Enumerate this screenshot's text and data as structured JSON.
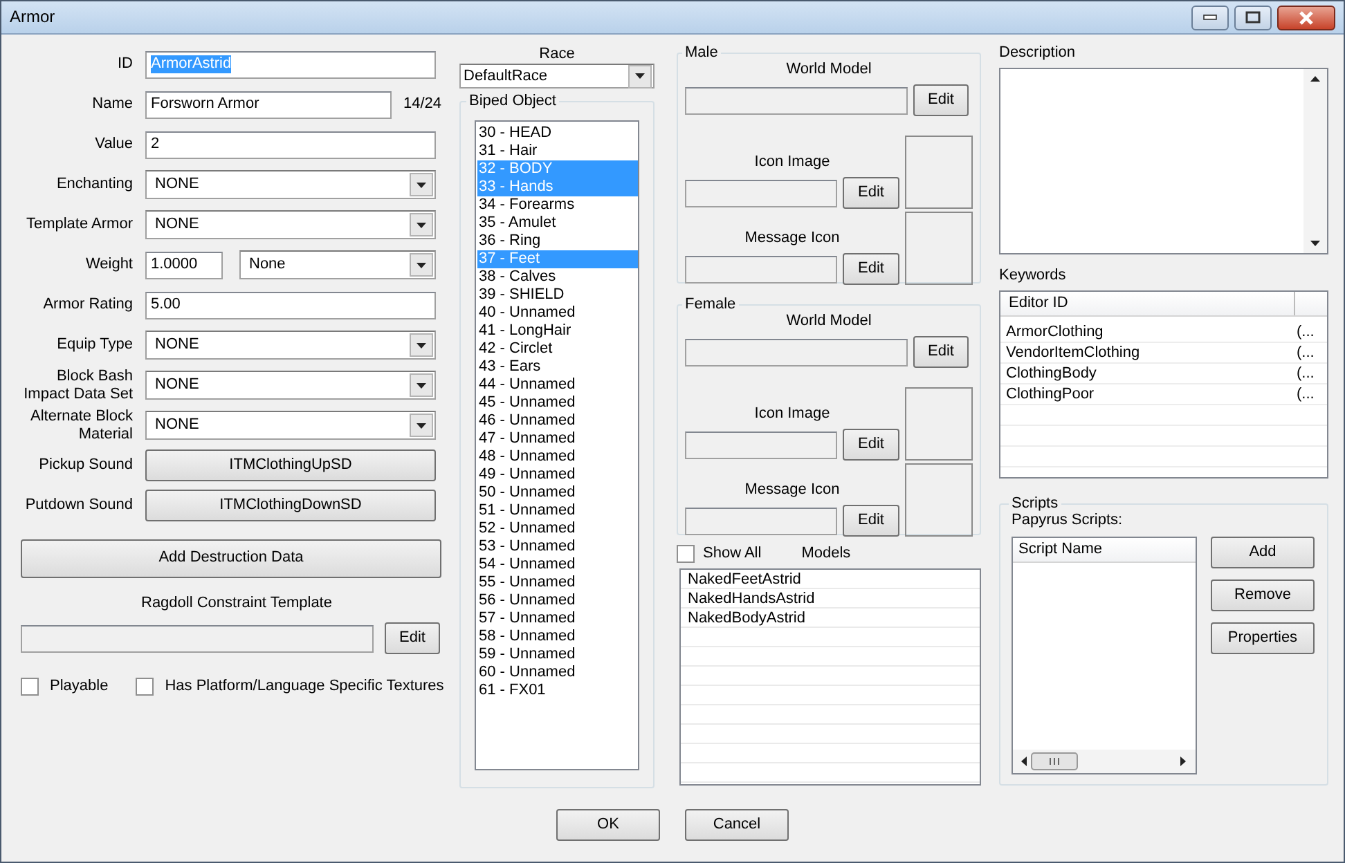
{
  "window": {
    "title": "Armor"
  },
  "fields": [
    {
      "kind": "text",
      "label": "ID",
      "value": "ArmorAstrid",
      "value_selected": true
    },
    {
      "kind": "text",
      "label": "Name",
      "value": "Forsworn Armor",
      "value_selected": false,
      "counter": "14/24"
    },
    {
      "kind": "text",
      "label": "Value",
      "value": "2",
      "value_selected": false
    },
    {
      "kind": "combo",
      "label": "Enchanting",
      "value": "NONE"
    },
    {
      "kind": "combo",
      "label": "Template Armor",
      "value": "NONE"
    },
    {
      "kind": "weight",
      "label": "Weight",
      "value": "1.0000",
      "option": "None"
    },
    {
      "kind": "text",
      "label": "Armor Rating",
      "value": "5.00",
      "value_selected": false
    },
    {
      "kind": "combo",
      "label": "Equip Type",
      "value": "NONE"
    },
    {
      "kind": "combo",
      "label": "Block Bash Impact Data Set",
      "value": "NONE"
    },
    {
      "kind": "combo",
      "label": "Alternate Block Material",
      "value": "NONE"
    },
    {
      "kind": "button",
      "label": "Pickup Sound",
      "value": "ITMClothingUpSD"
    },
    {
      "kind": "button",
      "label": "Putdown Sound",
      "value": "ITMClothingDownSD"
    }
  ],
  "destruction_button": "Add Destruction Data",
  "ragdoll": {
    "label": "Ragdoll Constraint Template",
    "button": "Edit"
  },
  "checkboxes": [
    {
      "label": "Playable",
      "checked": false
    },
    {
      "label": "Has Platform/Language Specific Textures",
      "checked": false
    }
  ],
  "race": {
    "label": "Race",
    "value": "DefaultRace"
  },
  "biped_object": {
    "title": "Biped Object",
    "items": [
      {
        "label": "30 - HEAD",
        "selected": false
      },
      {
        "label": "31 - Hair",
        "selected": false
      },
      {
        "label": "32 - BODY",
        "selected": true
      },
      {
        "label": "33 - Hands",
        "selected": true
      },
      {
        "label": "34 - Forearms",
        "selected": false
      },
      {
        "label": "35 - Amulet",
        "selected": false
      },
      {
        "label": "36 - Ring",
        "selected": false
      },
      {
        "label": "37 - Feet",
        "selected": true
      },
      {
        "label": "38 - Calves",
        "selected": false
      },
      {
        "label": "39 - SHIELD",
        "selected": false
      },
      {
        "label": "40 - Unnamed",
        "selected": false
      },
      {
        "label": "41 - LongHair",
        "selected": false
      },
      {
        "label": "42 - Circlet",
        "selected": false
      },
      {
        "label": "43 - Ears",
        "selected": false
      },
      {
        "label": "44 - Unnamed",
        "selected": false
      },
      {
        "label": "45 - Unnamed",
        "selected": false
      },
      {
        "label": "46 - Unnamed",
        "selected": false
      },
      {
        "label": "47 - Unnamed",
        "selected": false
      },
      {
        "label": "48 - Unnamed",
        "selected": false
      },
      {
        "label": "49 - Unnamed",
        "selected": false
      },
      {
        "label": "50 - Unnamed",
        "selected": false
      },
      {
        "label": "51 - Unnamed",
        "selected": false
      },
      {
        "label": "52 - Unnamed",
        "selected": false
      },
      {
        "label": "53 - Unnamed",
        "selected": false
      },
      {
        "label": "54 - Unnamed",
        "selected": false
      },
      {
        "label": "55 - Unnamed",
        "selected": false
      },
      {
        "label": "56 - Unnamed",
        "selected": false
      },
      {
        "label": "57 - Unnamed",
        "selected": false
      },
      {
        "label": "58 - Unnamed",
        "selected": false
      },
      {
        "label": "59 - Unnamed",
        "selected": false
      },
      {
        "label": "60 - Unnamed",
        "selected": false
      },
      {
        "label": "61 - FX01",
        "selected": false
      }
    ]
  },
  "genders": [
    {
      "title": "Male",
      "sections": [
        {
          "kind": "model",
          "label": "World Model",
          "button": "Edit"
        },
        {
          "kind": "image",
          "label": "Icon Image",
          "button": "Edit"
        },
        {
          "kind": "image",
          "label": "Message Icon",
          "button": "Edit"
        }
      ]
    },
    {
      "title": "Female",
      "sections": [
        {
          "kind": "model",
          "label": "World Model",
          "button": "Edit"
        },
        {
          "kind": "image",
          "label": "Icon Image",
          "button": "Edit"
        },
        {
          "kind": "image",
          "label": "Message Icon",
          "button": "Edit"
        }
      ]
    }
  ],
  "models": {
    "show_all": {
      "label": "Show All",
      "checked": false
    },
    "title": "Models",
    "items": [
      "NakedFeetAstrid",
      "NakedHandsAstrid",
      "NakedBodyAstrid"
    ]
  },
  "description": {
    "label": "Description"
  },
  "keywords": {
    "label": "Keywords",
    "columns": [
      "Editor ID"
    ],
    "rows": [
      {
        "editor_id": "ArmorClothing",
        "column_2": "(..."
      },
      {
        "editor_id": "VendorItemClothing",
        "column_2": "(..."
      },
      {
        "editor_id": "ClothingBody",
        "column_2": "(..."
      },
      {
        "editor_id": "ClothingPoor",
        "column_2": "(..."
      }
    ]
  },
  "scripts": {
    "title": "Scripts",
    "label": "Papyrus Scripts:",
    "columns": [
      "Script Name"
    ],
    "buttons": [
      "Add",
      "Remove",
      "Properties"
    ]
  },
  "buttons": [
    "OK",
    "Cancel"
  ]
}
